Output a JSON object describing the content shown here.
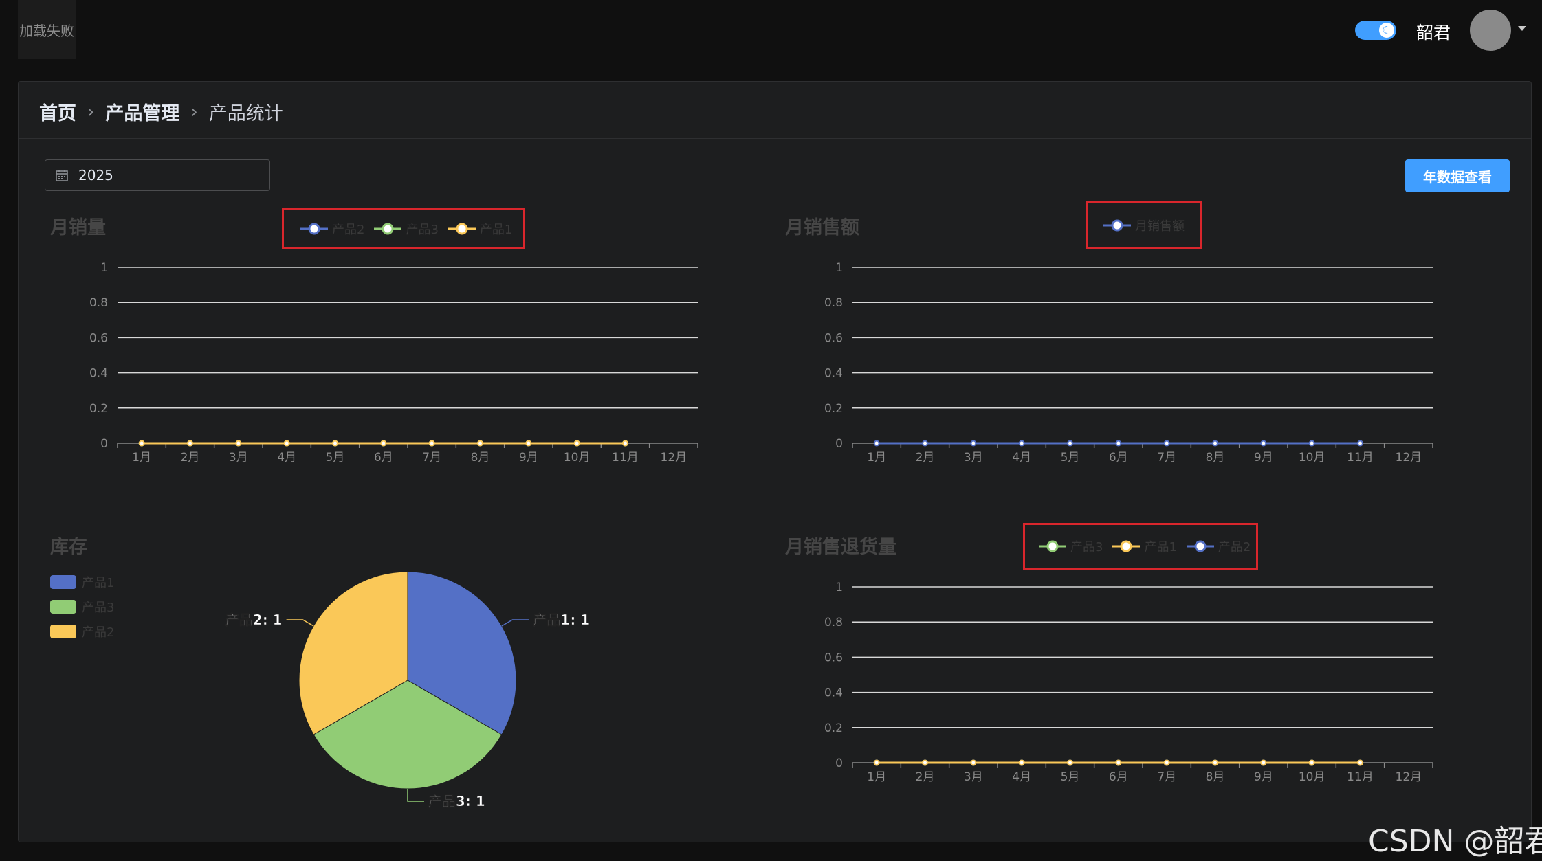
{
  "header": {
    "logo_text": "加载失败",
    "username": "韶君",
    "theme_toggle_on": true
  },
  "breadcrumb": {
    "items": [
      "首页",
      "产品管理",
      "产品统计"
    ]
  },
  "controls": {
    "year_value": "2025",
    "year_button_label": "年数据查看"
  },
  "colors": {
    "blue": "#5470c6",
    "green": "#91cc75",
    "yellow": "#fac858",
    "accent": "#409eff",
    "highlight_box": "#d9262c"
  },
  "watermark": "CSDN @韶君",
  "chart_data": [
    {
      "id": "monthly-sales",
      "type": "line",
      "title": "月销量",
      "categories": [
        "1月",
        "2月",
        "3月",
        "4月",
        "5月",
        "6月",
        "7月",
        "8月",
        "9月",
        "10月",
        "11月",
        "12月"
      ],
      "y_ticks": [
        "0",
        "0.2",
        "0.4",
        "0.6",
        "0.8",
        "1"
      ],
      "ylim": [
        0,
        1
      ],
      "legend": [
        {
          "name": "产品2",
          "color": "#5470c6"
        },
        {
          "name": "产品3",
          "color": "#91cc75"
        },
        {
          "name": "产品1",
          "color": "#fac858"
        }
      ],
      "series": [
        {
          "name": "产品2",
          "color": "#5470c6",
          "values": [
            0,
            0,
            0,
            0,
            0,
            0,
            0,
            0,
            0,
            0,
            0
          ]
        },
        {
          "name": "产品3",
          "color": "#91cc75",
          "values": [
            0,
            0,
            0,
            0,
            0,
            0,
            0,
            0,
            0,
            0,
            0
          ]
        },
        {
          "name": "产品1",
          "color": "#fac858",
          "values": [
            0,
            0,
            0,
            0,
            0,
            0,
            0,
            0,
            0,
            0,
            0
          ]
        }
      ]
    },
    {
      "id": "monthly-revenue",
      "type": "line",
      "title": "月销售额",
      "categories": [
        "1月",
        "2月",
        "3月",
        "4月",
        "5月",
        "6月",
        "7月",
        "8月",
        "9月",
        "10月",
        "11月",
        "12月"
      ],
      "y_ticks": [
        "0",
        "0.2",
        "0.4",
        "0.6",
        "0.8",
        "1"
      ],
      "ylim": [
        0,
        1
      ],
      "legend": [
        {
          "name": "月销售额",
          "color": "#5470c6"
        }
      ],
      "series": [
        {
          "name": "月销售额",
          "color": "#5470c6",
          "values": [
            0,
            0,
            0,
            0,
            0,
            0,
            0,
            0,
            0,
            0,
            0
          ]
        }
      ]
    },
    {
      "id": "inventory",
      "type": "pie",
      "title": "库存",
      "legend": [
        {
          "name": "产品1",
          "color": "#5470c6"
        },
        {
          "name": "产品3",
          "color": "#91cc75"
        },
        {
          "name": "产品2",
          "color": "#fac858"
        }
      ],
      "slices": [
        {
          "name": "产品1",
          "value": 1,
          "color": "#5470c6",
          "label": "产品1: 1"
        },
        {
          "name": "产品3",
          "value": 1,
          "color": "#91cc75",
          "label": "产品3: 1"
        },
        {
          "name": "产品2",
          "value": 1,
          "color": "#fac858",
          "label": "产品2: 1"
        }
      ]
    },
    {
      "id": "monthly-returns",
      "type": "line",
      "title": "月销售退货量",
      "categories": [
        "1月",
        "2月",
        "3月",
        "4月",
        "5月",
        "6月",
        "7月",
        "8月",
        "9月",
        "10月",
        "11月",
        "12月"
      ],
      "y_ticks": [
        "0",
        "0.2",
        "0.4",
        "0.6",
        "0.8",
        "1"
      ],
      "ylim": [
        0,
        1
      ],
      "legend": [
        {
          "name": "产品3",
          "color": "#91cc75"
        },
        {
          "name": "产品1",
          "color": "#fac858"
        },
        {
          "name": "产品2",
          "color": "#5470c6"
        }
      ],
      "series": [
        {
          "name": "产品3",
          "color": "#91cc75",
          "values": [
            0,
            0,
            0,
            0,
            0,
            0,
            0,
            0,
            0,
            0,
            0
          ]
        },
        {
          "name": "产品2",
          "color": "#5470c6",
          "values": [
            0,
            0,
            0,
            0,
            0,
            0,
            0,
            0,
            0,
            0,
            0
          ]
        },
        {
          "name": "产品1",
          "color": "#fac858",
          "values": [
            0,
            0,
            0,
            0,
            0,
            0,
            0,
            0,
            0,
            0,
            0
          ]
        }
      ]
    }
  ]
}
